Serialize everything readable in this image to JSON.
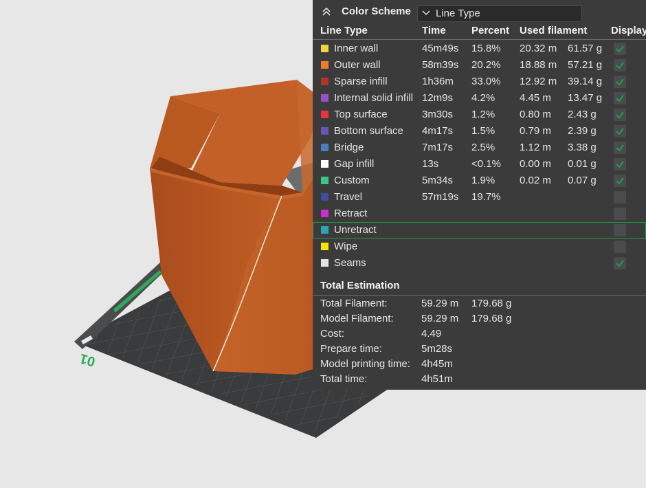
{
  "color_scheme": {
    "title": "Color Scheme",
    "selected": "Line Type",
    "collapse_icon": "double-chevron-up-icon"
  },
  "table": {
    "headers": [
      "Line Type",
      "Time",
      "Percent",
      "Used filament",
      "Display"
    ],
    "rows": [
      {
        "name": "Inner wall",
        "time": "45m49s",
        "percent": "15.8%",
        "length": "20.32 m",
        "weight": "61.57 g",
        "color": "#f2d33b",
        "display": true
      },
      {
        "name": "Outer wall",
        "time": "58m39s",
        "percent": "20.2%",
        "length": "18.88 m",
        "weight": "57.21 g",
        "color": "#ef7c2b",
        "display": true
      },
      {
        "name": "Sparse infill",
        "time": "1h36m",
        "percent": "33.0%",
        "length": "12.92 m",
        "weight": "39.14 g",
        "color": "#b2332b",
        "display": true
      },
      {
        "name": "Internal solid infill",
        "time": "12m9s",
        "percent": "4.2%",
        "length": "4.45 m",
        "weight": "13.47 g",
        "color": "#9a4fc4",
        "display": true
      },
      {
        "name": "Top surface",
        "time": "3m30s",
        "percent": "1.2%",
        "length": "0.80 m",
        "weight": "2.43 g",
        "color": "#e8343a",
        "display": true
      },
      {
        "name": "Bottom surface",
        "time": "4m17s",
        "percent": "1.5%",
        "length": "0.79 m",
        "weight": "2.39 g",
        "color": "#6a54b4",
        "display": true
      },
      {
        "name": "Bridge",
        "time": "7m17s",
        "percent": "2.5%",
        "length": "1.12 m",
        "weight": "3.38 g",
        "color": "#4a7fbe",
        "display": true
      },
      {
        "name": "Gap infill",
        "time": "13s",
        "percent": "<0.1%",
        "length": "0.00 m",
        "weight": "0.01 g",
        "color": "#ffffff",
        "display": true
      },
      {
        "name": "Custom",
        "time": "5m34s",
        "percent": "1.9%",
        "length": "0.02 m",
        "weight": "0.07 g",
        "color": "#3ec58a",
        "display": true
      },
      {
        "name": "Travel",
        "time": "57m19s",
        "percent": "19.7%",
        "length": "",
        "weight": "",
        "color": "#3b4ea0",
        "display": false
      },
      {
        "name": "Retract",
        "time": "",
        "percent": "",
        "length": "",
        "weight": "",
        "color": "#cc2fcc",
        "display": false
      },
      {
        "name": "Unretract",
        "time": "",
        "percent": "",
        "length": "",
        "weight": "",
        "color": "#2aa6b4",
        "display": false,
        "selected": true
      },
      {
        "name": "Wipe",
        "time": "",
        "percent": "",
        "length": "",
        "weight": "",
        "color": "#f7e400",
        "display": false
      },
      {
        "name": "Seams",
        "time": "",
        "percent": "",
        "length": "",
        "weight": "",
        "color": "#e2e2e2",
        "display": true
      }
    ]
  },
  "total": {
    "title": "Total Estimation",
    "items": [
      {
        "label": "Total Filament:",
        "value": "59.29 m",
        "value2": "179.68 g"
      },
      {
        "label": "Model Filament:",
        "value": "59.29 m",
        "value2": "179.68 g"
      },
      {
        "label": "Cost:",
        "value": "4.49",
        "value2": ""
      },
      {
        "label": "Prepare time:",
        "value": "5m28s",
        "value2": ""
      },
      {
        "label": "Model printing time:",
        "value": "4h45m",
        "value2": ""
      },
      {
        "label": "Total time:",
        "value": "4h51m",
        "value2": ""
      }
    ]
  },
  "viewport": {
    "plate_label": "01",
    "model_color": "#bd5b22",
    "plate_color": "#3a3b3c"
  },
  "colors": {
    "panel_bg": "#3b3b3c",
    "check": "#1fa14a",
    "accent_green": "#1fa14a"
  }
}
